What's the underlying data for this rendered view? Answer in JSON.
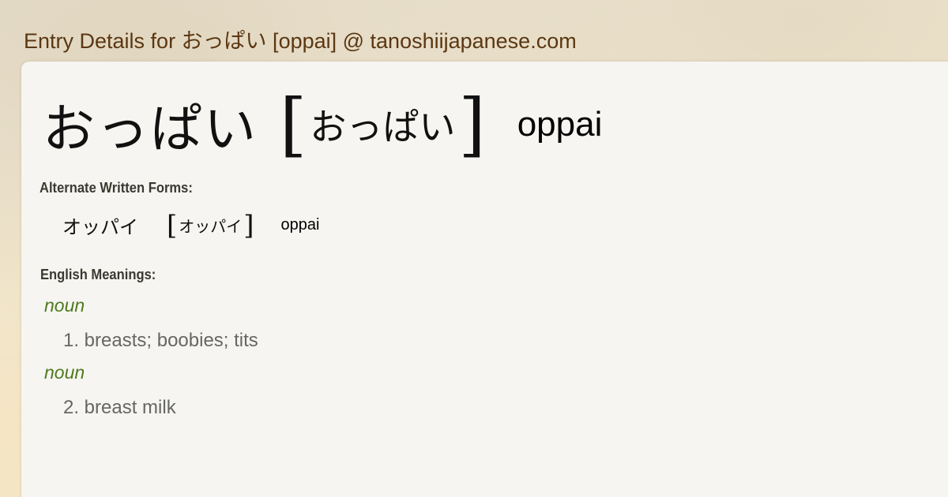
{
  "site": {
    "title": "Entry Details for おっぱい [oppai] @ tanoshiijapanese.com"
  },
  "entry": {
    "headword": "おっぱい",
    "bracket_open": "[",
    "bracket_close": "]",
    "reading": "おっぱい",
    "romaji": "oppai"
  },
  "alternate_forms": {
    "label": "Alternate Written Forms:",
    "items": [
      {
        "form": "オッパイ",
        "bracket_open": "[",
        "reading": "オッパイ",
        "bracket_close": "]",
        "romaji": "oppai"
      }
    ]
  },
  "meanings": {
    "label": "English Meanings:",
    "items": [
      {
        "pos": "noun",
        "text": "1. breasts; boobies; tits"
      },
      {
        "pos": "noun",
        "text": "2. breast milk"
      }
    ]
  },
  "colors": {
    "title": "#5b3712",
    "pos": "#4d7a1e",
    "meaning": "#666666",
    "card": "#f7f5f1"
  }
}
